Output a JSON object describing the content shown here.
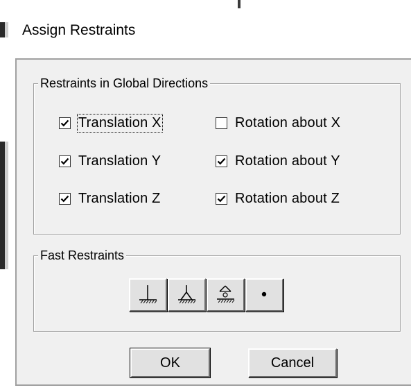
{
  "dialog": {
    "title": "Assign Restraints"
  },
  "global_directions": {
    "legend": "Restraints in Global Directions",
    "translation": [
      {
        "label": "Translation X",
        "checked": true,
        "focused": true
      },
      {
        "label": "Translation Y",
        "checked": true,
        "focused": false
      },
      {
        "label": "Translation Z",
        "checked": true,
        "focused": false
      }
    ],
    "rotation": [
      {
        "label": "Rotation about X",
        "checked": false
      },
      {
        "label": "Rotation about Y",
        "checked": true
      },
      {
        "label": "Rotation about Z",
        "checked": true
      }
    ]
  },
  "fast_restraints": {
    "legend": "Fast Restraints",
    "buttons": [
      {
        "icon": "fixed-support-icon"
      },
      {
        "icon": "pinned-support-icon"
      },
      {
        "icon": "roller-support-icon"
      },
      {
        "icon": "free-joint-icon"
      }
    ]
  },
  "actions": {
    "ok_label": "OK",
    "cancel_label": "Cancel"
  },
  "colors": {
    "dialog_face": "#f0f0f0",
    "button_face": "#e1e1e1",
    "group_border": "#a0a0a0"
  }
}
